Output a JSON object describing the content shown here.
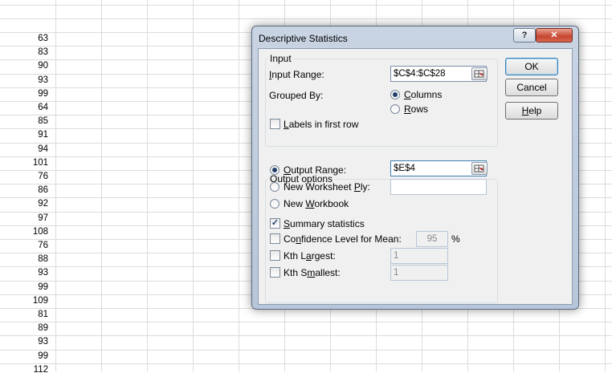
{
  "sheet": {
    "values": [
      "63",
      "83",
      "90",
      "93",
      "99",
      "64",
      "85",
      "91",
      "94",
      "101",
      "76",
      "86",
      "92",
      "97",
      "108",
      "76",
      "88",
      "93",
      "99",
      "109",
      "81",
      "89",
      "93",
      "99",
      "112"
    ]
  },
  "dialog": {
    "title": "Descriptive Statistics",
    "titlebar_help": "?",
    "titlebar_close": "✕",
    "input_group": {
      "label": "Input",
      "input_range_label": "Input Range:",
      "input_range_value": "$C$4:$C$28",
      "grouped_by_label": "Grouped By:",
      "columns_label": "Columns",
      "rows_label": "Rows",
      "grouped_by_selected": "Columns",
      "labels_first_row_label": "Labels in first row",
      "labels_first_row_checked": false
    },
    "output_group": {
      "label": "Output options",
      "output_range_label": "Output Range:",
      "output_range_value": "$E$4",
      "new_ply_label": "New Worksheet Ply:",
      "new_ply_value": "",
      "new_workbook_label": "New Workbook",
      "output_selected": "Output Range",
      "summary_label": "Summary statistics",
      "summary_checked": true,
      "confidence_label": "Confidence Level for Mean:",
      "confidence_value": "95",
      "confidence_unit": "%",
      "confidence_checked": false,
      "kth_largest_label": "Kth Largest:",
      "kth_largest_value": "1",
      "kth_largest_checked": false,
      "kth_smallest_label": "Kth Smallest:",
      "kth_smallest_value": "1",
      "kth_smallest_checked": false
    },
    "buttons": {
      "ok": "OK",
      "cancel": "Cancel",
      "help": "Help"
    }
  },
  "colors": {
    "grid": "#dadcdd",
    "dialog_frame": "#b7c6da",
    "close_button": "#c64530"
  }
}
